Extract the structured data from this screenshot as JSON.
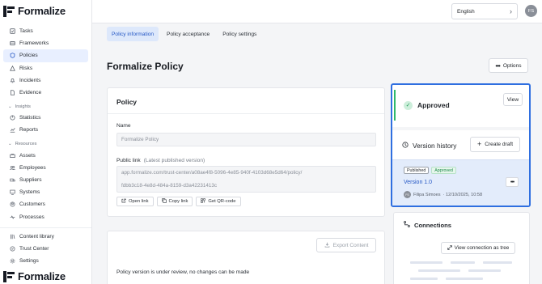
{
  "brand": {
    "name": "Formalize"
  },
  "sidebar": {
    "items": [
      {
        "label": "Tasks",
        "icon": "task-icon"
      },
      {
        "label": "Frameworks",
        "icon": "framework-icon"
      },
      {
        "label": "Policies",
        "icon": "shield-icon",
        "active": true
      },
      {
        "label": "Risks",
        "icon": "warning-icon"
      },
      {
        "label": "Incidents",
        "icon": "bell-icon"
      },
      {
        "label": "Evidence",
        "icon": "evidence-icon"
      }
    ],
    "insights_label": "Insights",
    "insights": [
      {
        "label": "Statistics",
        "icon": "chart-icon"
      },
      {
        "label": "Reports",
        "icon": "report-icon"
      }
    ],
    "resources_label": "Resources",
    "resources": [
      {
        "label": "Assets",
        "icon": "asset-icon"
      },
      {
        "label": "Employees",
        "icon": "people-icon"
      },
      {
        "label": "Suppliers",
        "icon": "truck-icon"
      },
      {
        "label": "Systems",
        "icon": "system-icon"
      },
      {
        "label": "Customers",
        "icon": "customer-icon"
      },
      {
        "label": "Processes",
        "icon": "process-icon"
      }
    ],
    "bottom": [
      {
        "label": "Content library",
        "icon": "library-icon"
      },
      {
        "label": "Trust Center",
        "icon": "trust-icon"
      },
      {
        "label": "Settings",
        "icon": "gear-icon"
      }
    ]
  },
  "topbar": {
    "language": "English",
    "avatar_initials": "FS"
  },
  "tabs": [
    {
      "label": "Policy information",
      "active": true
    },
    {
      "label": "Policy acceptance"
    },
    {
      "label": "Policy settings"
    }
  ],
  "page": {
    "title": "Formalize Policy",
    "options_label": "Options"
  },
  "policy_card": {
    "title": "Policy",
    "name_label": "Name",
    "name_value": "Formalize Policy",
    "public_link_label": "Public link",
    "public_link_hint": "(Latest published version)",
    "public_link_line1": "app.formalize.com/trust-center/a08ae4f8-5096-4e85-940f-4103d68e5d64/policy/",
    "public_link_line2": "fdbb3c18-4e8d-484a-8159-d3a42231413c",
    "open_link": "Open link",
    "copy_link": "Copy link",
    "qr_code": "Get QR-code"
  },
  "export_card": {
    "export_label": "Export Content",
    "note": "Policy version is under review, no changes can be made"
  },
  "status_panel": {
    "status": "Approved",
    "view_label": "View",
    "version_history_title": "Version history",
    "create_draft": "Create draft",
    "version": {
      "published_badge": "Published",
      "approved_badge": "Approved",
      "name": "Version 1.0",
      "author_initials": "FS",
      "author": "Filipa Simoes",
      "date": "· 12/10/2025, 10:58"
    }
  },
  "connections": {
    "title": "Connections",
    "view_tree": "View connection as tree"
  }
}
